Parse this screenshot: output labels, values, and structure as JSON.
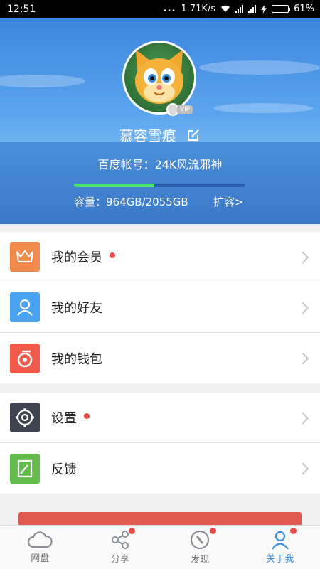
{
  "status_bar": {
    "time": "12:51",
    "dots": "...",
    "speed": "1.71K/s",
    "battery": "61%",
    "battery_level": 0.61
  },
  "profile": {
    "vip_badge": "VIP",
    "username": "慕容雪痕",
    "account_text": "百度帐号：24K风流邪神",
    "storage_text": "容量：964GB/2055GB",
    "storage_fraction": 0.469,
    "expand_label": "扩容>"
  },
  "menu_groups": [
    [
      {
        "label": "我的会员",
        "icon": "crown-icon",
        "color": "#f08a4b",
        "dot": true
      },
      {
        "label": "我的好友",
        "icon": "person-icon",
        "color": "#4aa3f0",
        "dot": false
      },
      {
        "label": "我的钱包",
        "icon": "wallet-icon",
        "color": "#ef5a4b",
        "dot": false
      }
    ],
    [
      {
        "label": "设置",
        "icon": "gear-icon",
        "color": "#3f4450",
        "dot": true
      },
      {
        "label": "反馈",
        "icon": "feedback-icon",
        "color": "#63bb4b",
        "dot": false
      }
    ]
  ],
  "tabs": [
    {
      "label": "网盘",
      "icon": "cloud-icon",
      "dot": false,
      "active": false
    },
    {
      "label": "分享",
      "icon": "share-icon",
      "dot": true,
      "active": false
    },
    {
      "label": "发现",
      "icon": "compass-icon",
      "dot": true,
      "active": false
    },
    {
      "label": "关于我",
      "icon": "person-icon",
      "dot": true,
      "active": true
    }
  ],
  "colors": {
    "accent": "#3a8fe5",
    "badge_red": "#e84b46",
    "header_blue": "#4a90e2"
  }
}
